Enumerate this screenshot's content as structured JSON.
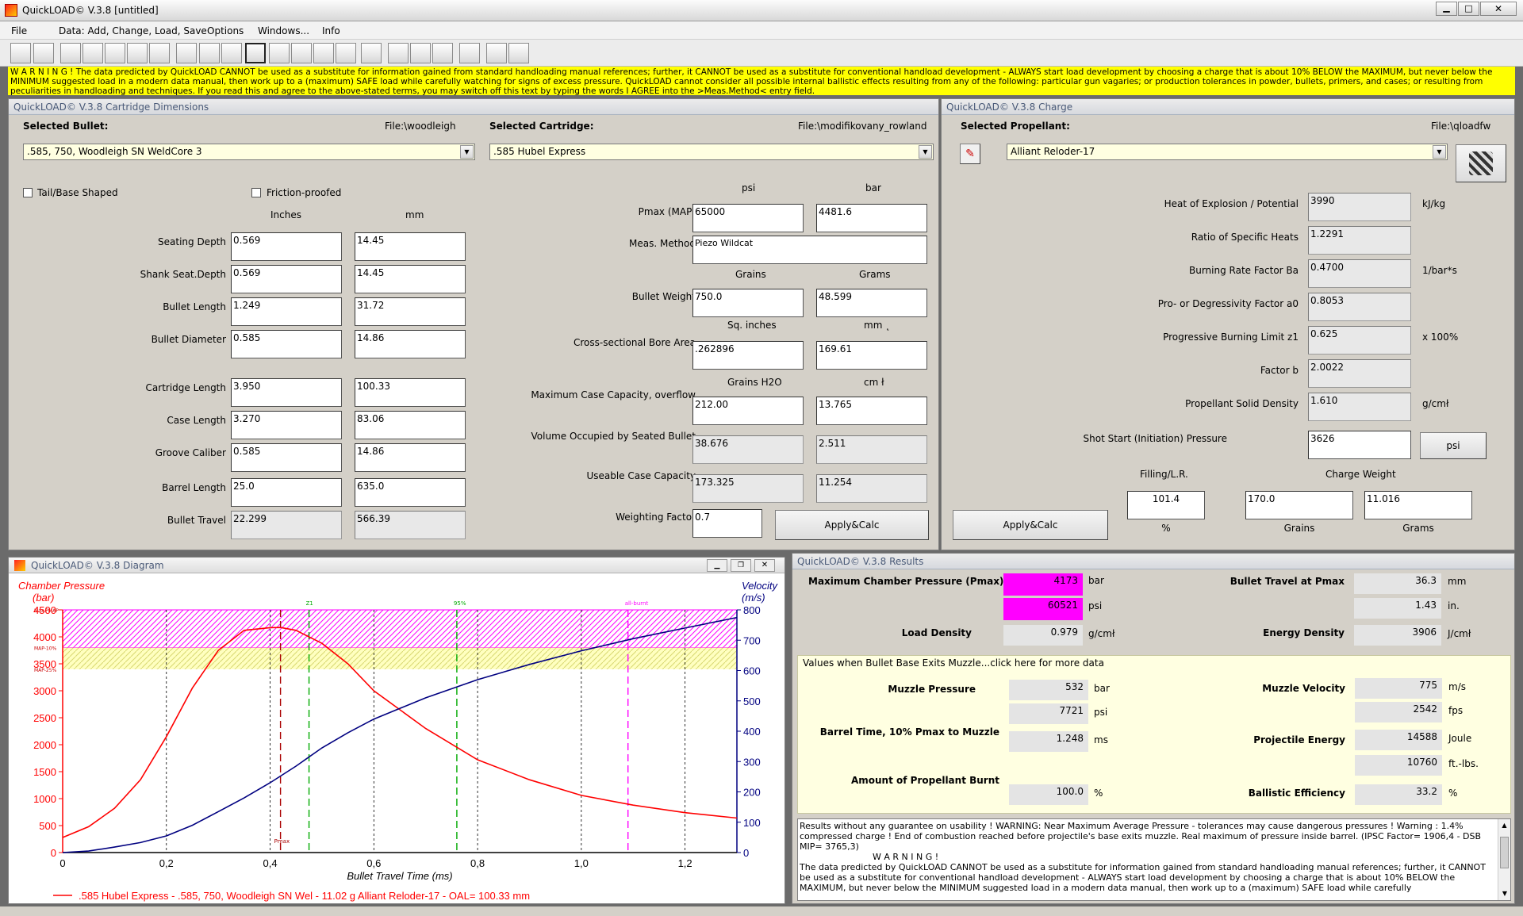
{
  "window": {
    "title": "QuickLOAD© V.3.8   [untitled]"
  },
  "menu": [
    "File",
    "Data: Add, Change, Load, Save",
    "Options",
    "Windows...",
    "Info"
  ],
  "warning": "W A R N I N G ! The data predicted by QuickLOAD CANNOT be used as a substitute for information gained from standard handloading manual references; further, it CANNOT be used as a substitute for conventional handload development - ALWAYS start load development by choosing a charge that is about 10% BELOW the MAXIMUM, but never below the MINIMUM suggested load in a modern data manual, then work up to a (maximum) SAFE load while carefully watching for signs of excess pressure. QuickLOAD cannot consider all possible internal ballistic effects resulting from any of the following: particular gun vagaries; or production tolerances in powder, bullets, primers, and cases; or resulting from peculiarities in handloading and techniques. If you read this and agree to the above-stated terms, you may switch off this text by typing the words I AGREE into the >Meas.Method< entry field.",
  "dims": {
    "title": "QuickLOAD© V.3.8 Cartridge Dimensions",
    "bullet_label": "Selected Bullet:",
    "bullet_file": "File:\\woodleigh",
    "bullet": ".585, 750, Woodleigh SN WeldCore 3",
    "cart_label": "Selected Cartridge:",
    "cart_file": "File:\\modifikovany_rowland",
    "cartridge": ".585 Hubel Express",
    "tail": "Tail/Base Shaped",
    "friction": "Friction-proofed",
    "col_in": "Inches",
    "col_mm": "mm",
    "rows": [
      {
        "label": "Seating Depth",
        "in": "0.569",
        "mm": "14.45"
      },
      {
        "label": "Shank Seat.Depth",
        "in": "0.569",
        "mm": "14.45"
      },
      {
        "label": "Bullet Length",
        "in": "1.249",
        "mm": "31.72"
      },
      {
        "label": "Bullet Diameter",
        "in": "0.585",
        "mm": "14.86"
      },
      {
        "label": "Cartridge Length",
        "in": "3.950",
        "mm": "100.33"
      },
      {
        "label": "Case Length",
        "in": "3.270",
        "mm": "83.06"
      },
      {
        "label": "Groove Caliber",
        "in": "0.585",
        "mm": "14.86"
      },
      {
        "label": "Barrel Length",
        "in": "25.0",
        "mm": "635.0"
      },
      {
        "label": "Bullet Travel",
        "in": "22.299",
        "mm": "566.39"
      }
    ],
    "psi": "psi",
    "bar": "bar",
    "pmax_label": "Pmax (MAP)",
    "pmax_psi": "65000",
    "pmax_bar": "4481.6",
    "meas_label": "Meas. Method",
    "meas": "Piezo Wildcat",
    "grains": "Grains",
    "grams": "Grams",
    "bw_label": "Bullet Weight",
    "bw_gr": "750.0",
    "bw_g": "48.599",
    "sqin": "Sq. inches",
    "mm2": "mm ˛",
    "bore_label": "Cross-sectional Bore Area",
    "bore_in": ".262896",
    "bore_mm": "169.61",
    "gh2o": "Grains H2O",
    "cm3": "cm ł",
    "cap_label": "Maximum Case Capacity, overflow",
    "cap_gr": "212.00",
    "cap_cm": "13.765",
    "vol_label": "Volume Occupied by Seated Bullet",
    "vol_gr": "38.676",
    "vol_cm": "2.511",
    "use_label": "Useable Case Capacity",
    "use_gr": "173.325",
    "use_cm": "11.254",
    "wf_label": "Weighting Factor",
    "wf": "0.7",
    "apply": "Apply&Calc"
  },
  "charge": {
    "title": "QuickLOAD© V.3.8 Charge",
    "prop_label": "Selected Propellant:",
    "prop_file": "File:\\qloadfw",
    "propellant": "Alliant Reloder-17",
    "rows": [
      {
        "label": "Heat of Explosion / Potential",
        "value": "3990",
        "unit": "kJ/kg"
      },
      {
        "label": "Ratio of Specific Heats",
        "value": "1.2291",
        "unit": ""
      },
      {
        "label": "Burning Rate Factor  Ba",
        "value": "0.4700",
        "unit": "1/bar*s"
      },
      {
        "label": "Pro- or Degressivity Factor  a0",
        "value": "0.8053",
        "unit": ""
      },
      {
        "label": "Progressive Burning Limit z1",
        "value": "0.625",
        "unit": "x 100%"
      },
      {
        "label": "Factor  b",
        "value": "2.0022",
        "unit": ""
      },
      {
        "label": "Propellant Solid Density",
        "value": "1.610",
        "unit": "g/cmł"
      }
    ],
    "shot_label": "Shot Start (Initiation) Pressure",
    "shot": "3626",
    "psi_btn": "psi",
    "fill_label": "Filling/L.R.",
    "cw_label": "Charge Weight",
    "fill": "101.4",
    "cw_gr": "170.0",
    "cw_g": "11.016",
    "pct": "%",
    "grains": "Grains",
    "grams": "Grams",
    "apply": "Apply&Calc"
  },
  "diagram": {
    "title": "QuickLOAD© V.3.8 Diagram",
    "legend": ".585 Hubel Express - .585, 750, Woodleigh SN Wel - 11.02 g Alliant Reloder-17 - OAL= 100.33 mm"
  },
  "chart_data": {
    "type": "line",
    "title": "",
    "xlabel": "Bullet Travel Time (ms)",
    "ylabel": "Chamber Pressure (bar)",
    "y2label": "Velocity (m/s)",
    "xlim": [
      0,
      1.3
    ],
    "ylim": [
      0,
      4500
    ],
    "y2lim": [
      0,
      800
    ],
    "xticks": [
      "0",
      "0,2",
      "0,4",
      "0,6",
      "0,8",
      "1,0",
      "1,2"
    ],
    "yticks": [
      "0",
      "500",
      "1000",
      "1500",
      "2000",
      "2500",
      "3000",
      "3500",
      "4000",
      "4500"
    ],
    "y2ticks": [
      "0",
      "100",
      "200",
      "300",
      "400",
      "500",
      "600",
      "700",
      "800"
    ],
    "markers": [
      {
        "label": "Pmax",
        "x": 0.42
      },
      {
        "label": "Z1",
        "x": 0.475
      },
      {
        "label": "95%",
        "x": 0.76
      },
      {
        "label": "all-burnt",
        "x": 1.09
      }
    ],
    "bands": [
      {
        "label": "Max.PMAP",
        "from": 3800,
        "to": 4500
      },
      {
        "label": "MAP-10%",
        "from": 3400,
        "to": 3800
      },
      {
        "label": "MAP-25%"
      }
    ],
    "series": [
      {
        "name": ".585 Hubel Express - .585, 750, Woodleigh SN Wel - 11.02 g Alliant Reloder-17 - OAL= 100.33 mm",
        "color": "#ff0000",
        "axis": "left",
        "x": [
          0,
          0.05,
          0.1,
          0.15,
          0.2,
          0.25,
          0.3,
          0.35,
          0.4,
          0.42,
          0.45,
          0.5,
          0.55,
          0.6,
          0.7,
          0.8,
          0.9,
          1.0,
          1.1,
          1.2,
          1.3
        ],
        "y": [
          280,
          480,
          820,
          1350,
          2150,
          3050,
          3750,
          4120,
          4170,
          4173,
          4120,
          3880,
          3500,
          3000,
          2300,
          1720,
          1350,
          1060,
          880,
          740,
          640
        ]
      },
      {
        "name": "Velocity",
        "color": "#000080",
        "axis": "right",
        "x": [
          0,
          0.05,
          0.1,
          0.15,
          0.2,
          0.25,
          0.3,
          0.35,
          0.4,
          0.45,
          0.5,
          0.55,
          0.6,
          0.65,
          0.7,
          0.8,
          0.9,
          1.0,
          1.1,
          1.2,
          1.3
        ],
        "y": [
          0,
          5,
          18,
          33,
          55,
          90,
          135,
          180,
          230,
          285,
          345,
          395,
          440,
          475,
          510,
          570,
          620,
          665,
          705,
          740,
          775
        ]
      }
    ]
  },
  "results": {
    "title": "QuickLOAD© V.3.8 Results",
    "pmax_label": "Maximum Chamber Pressure (Pmax)",
    "pmax_bar": "4173",
    "bar": "bar",
    "pmax_psi": "60521",
    "psi": "psi",
    "ld_label": "Load Density",
    "ld": "0.979",
    "ld_unit": "g/cmł",
    "bt_label": "Bullet Travel at Pmax",
    "bt_mm": "36.3",
    "mm": "mm",
    "bt_in": "1.43",
    "in": "in.",
    "ed_label": "Energy Density",
    "ed": "3906",
    "ed_unit": "J/cmł",
    "group": "Values when Bullet Base Exits Muzzle...click here for more data",
    "mp_label": "Muzzle Pressure",
    "mp_bar": "532",
    "mp_psi": "7721",
    "bt10_label": "Barrel Time, 10% Pmax to Muzzle",
    "bt10": "1.248",
    "ms": "ms",
    "apb_label": "Amount of Propellant Burnt",
    "apb": "100.0",
    "pct": "%",
    "mv_label": "Muzzle Velocity",
    "mv_ms": "775",
    "ms_unit": "m/s",
    "mv_fps": "2542",
    "fps": "fps",
    "pe_label": "Projectile Energy",
    "pe_j": "14588",
    "joule": "Joule",
    "pe_ft": "10760",
    "ftlbs": "ft.-lbs.",
    "be_label": "Ballistic Efficiency",
    "be": "33.2",
    "notes1": "Results without any guarantee on usability !  WARNING: Near Maximum Average Pressure - tolerances may cause dangerous pressures !  Warning : 1.4% compressed charge !  End of combustion reached before projectile's base exits muzzle.  Real maximum of pressure inside barrel.  (IPSC Factor= 1906,4 - DSB MIP= 3765,3)",
    "notes2": "W A R N I N G !",
    "notes3": "The data predicted by QuickLOAD CANNOT be used as a substitute for information gained from standard handloading manual references; further, it CANNOT be used as a substitute for conventional handload development - ALWAYS start load development by choosing a charge that is about 10% BELOW the MAXIMUM, but never below the MINIMUM suggested load in a modern data manual, then work up to a (maximum) SAFE load while carefully"
  }
}
